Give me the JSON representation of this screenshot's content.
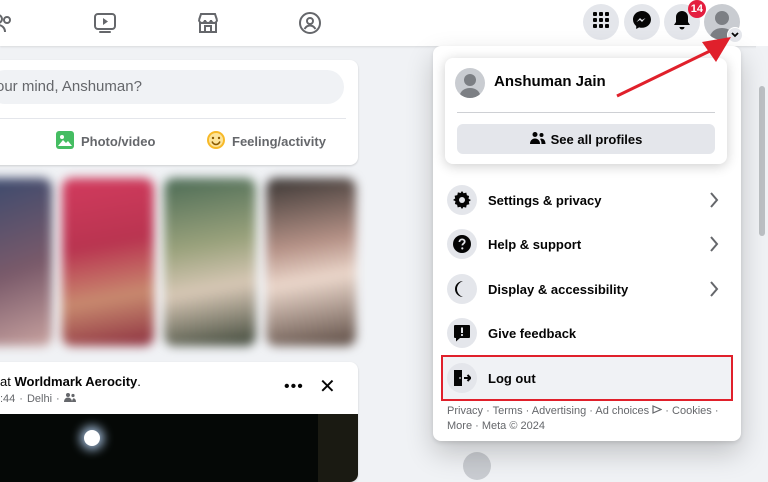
{
  "nav": {
    "notification_count": "14"
  },
  "composer": {
    "placeholder": "our mind, Anshuman?",
    "actions": [
      {
        "label": "Photo/video",
        "icon": "photo-icon"
      },
      {
        "label": "Feeling/activity",
        "icon": "feeling-icon"
      }
    ]
  },
  "post": {
    "location_prefix": "at",
    "location": "Worldmark Aerocity",
    "location_suffix": ".",
    "meta_time": ":44",
    "meta_place": "Delhi",
    "more_label": "•••",
    "close_label": "✕"
  },
  "dropdown": {
    "profile_name": "Anshuman Jain",
    "see_all_profiles": "See all profiles",
    "items": [
      {
        "label": "Settings & privacy",
        "icon": "gear-icon"
      },
      {
        "label": "Help & support",
        "icon": "question-icon"
      },
      {
        "label": "Display & accessibility",
        "icon": "moon-icon"
      },
      {
        "label": "Give feedback",
        "icon": "feedback-icon"
      },
      {
        "label": "Log out",
        "icon": "logout-icon"
      }
    ],
    "footer": {
      "privacy": "Privacy",
      "terms": "Terms",
      "advertising": "Advertising",
      "ad_choices": "Ad choices",
      "cookies": "Cookies",
      "more": "More",
      "meta": "Meta © 2024"
    }
  },
  "colors": {
    "facebook_blue": "#1877f2",
    "badge_red": "#e41e3f",
    "highlight_red": "#e0202b"
  }
}
